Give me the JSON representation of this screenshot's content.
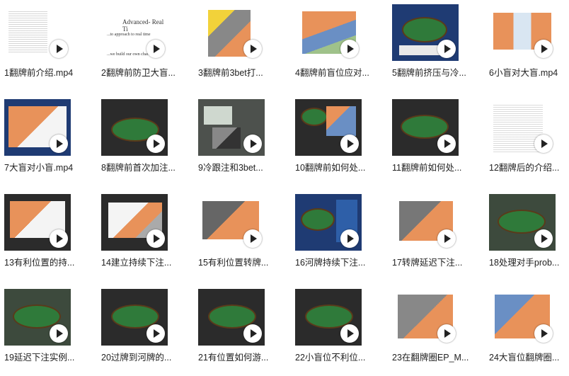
{
  "videos": [
    {
      "label": "1翻牌前介绍.mp4"
    },
    {
      "label": "2翻牌前防卫大盲..."
    },
    {
      "label": "3翻牌前3bet打..."
    },
    {
      "label": "4翻牌前盲位应对..."
    },
    {
      "label": "5翻牌前挤压与冷..."
    },
    {
      "label": "6小盲对大盲.mp4"
    },
    {
      "label": "7大盲对小盲.mp4"
    },
    {
      "label": "8翻牌前首次加注..."
    },
    {
      "label": "9冷跟注和3bet..."
    },
    {
      "label": "10翻牌前如何处..."
    },
    {
      "label": "11翻牌前如何处..."
    },
    {
      "label": "12翻牌后的介绍..."
    },
    {
      "label": "13有利位置的持..."
    },
    {
      "label": "14建立持续下注..."
    },
    {
      "label": "15有利位置转牌..."
    },
    {
      "label": "16河牌持续下注..."
    },
    {
      "label": "17转牌延迟下注..."
    },
    {
      "label": "18处理对手prob..."
    },
    {
      "label": "19延迟下注实例..."
    },
    {
      "label": "20过牌到河牌的..."
    },
    {
      "label": "21有位置如何游..."
    },
    {
      "label": "22小盲位不利位..."
    },
    {
      "label": "23在翻牌圈EP_M..."
    },
    {
      "label": "24大盲位翻牌圈..."
    }
  ],
  "thumb_art": {
    "slide_1": "Advanced- Real Ti",
    "slide_2": "...to approach to real time",
    "slide_3": "...we build our own charts"
  },
  "colors": {
    "play_button": "#ffffff",
    "felt": "#2f7a3a",
    "chart_orange": "#e8925a",
    "chart_blue": "#6a8fc4",
    "chart_yellow": "#f2d23a"
  }
}
